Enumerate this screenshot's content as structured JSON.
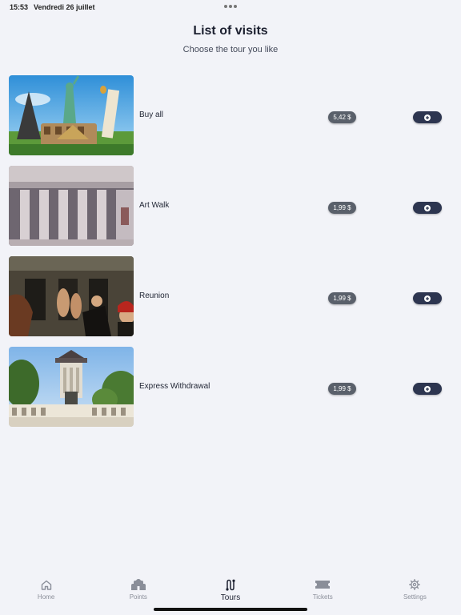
{
  "status_bar": {
    "time": "15:53",
    "date": "Vendredi 26 juillet"
  },
  "header": {
    "title": "List of visits",
    "subtitle": "Choose the tour you like"
  },
  "tours": [
    {
      "name": "Buy all",
      "price": "5,42 $",
      "image": "world-landmarks"
    },
    {
      "name": "Art Walk",
      "price": "1,99 $",
      "image": "museum-columns"
    },
    {
      "name": "Reunion",
      "price": "1,99 $",
      "image": "renaissance-painting"
    },
    {
      "name": "Express Withdrawal",
      "price": "1,99 $",
      "image": "park-monument"
    }
  ],
  "tab_bar": {
    "items": [
      {
        "label": "Home",
        "icon": "home-icon",
        "active": false
      },
      {
        "label": "Points",
        "icon": "points-icon",
        "active": false
      },
      {
        "label": "Tours",
        "icon": "tours-icon",
        "active": true
      },
      {
        "label": "Tickets",
        "icon": "ticket-icon",
        "active": false
      },
      {
        "label": "Settings",
        "icon": "gear-icon",
        "active": false
      }
    ]
  },
  "colors": {
    "background": "#f2f3f8",
    "price_badge": "#5a606b",
    "add_button": "#2d3550",
    "accent_text": "#1c2030"
  }
}
